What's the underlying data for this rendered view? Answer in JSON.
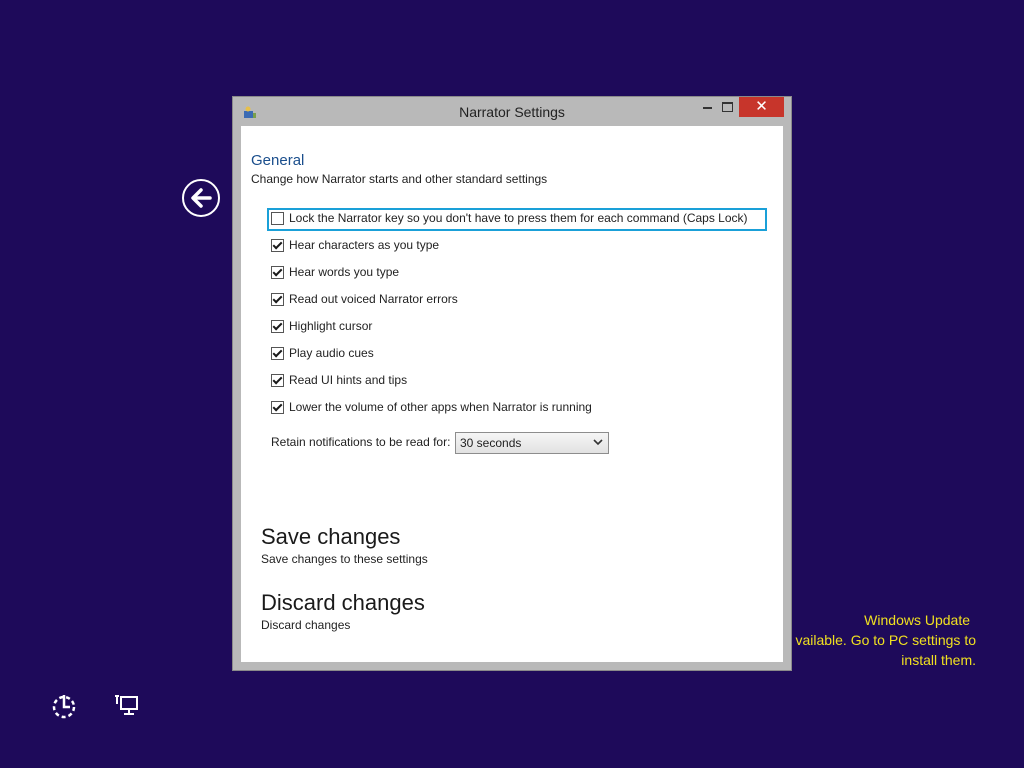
{
  "window": {
    "title": "Narrator Settings",
    "close_glyph": "✕"
  },
  "general": {
    "heading": "General",
    "subtitle": "Change how Narrator starts and other standard settings"
  },
  "options": [
    {
      "label": "Lock the Narrator key so you don't have to press them for each command (Caps Lock)",
      "checked": false
    },
    {
      "label": "Hear characters as you type",
      "checked": true
    },
    {
      "label": "Hear words you type",
      "checked": true
    },
    {
      "label": "Read out voiced Narrator errors",
      "checked": true
    },
    {
      "label": "Highlight cursor",
      "checked": true
    },
    {
      "label": "Play audio cues",
      "checked": true
    },
    {
      "label": "Read UI hints and tips",
      "checked": true
    },
    {
      "label": "Lower the volume of other apps when Narrator is running",
      "checked": true
    }
  ],
  "retain": {
    "label": "Retain notifications to be read for:",
    "selected": "30 seconds"
  },
  "save": {
    "title": "Save changes",
    "desc": "Save changes to these settings"
  },
  "discard": {
    "title": "Discard changes",
    "desc": "Discard changes"
  },
  "notification": {
    "line1": "Windows Update",
    "line2": "vailable. Go to PC settings to",
    "line3": "install them."
  },
  "colors": {
    "desktop": "#1e0a5a",
    "focus_border": "#1aa0d8",
    "close_button": "#c7352b",
    "heading": "#1a4e8c",
    "notification_text": "#f0e020"
  },
  "icons": [
    "back-arrow-icon",
    "narrator-app-icon",
    "ease-of-access-icon",
    "network-icon",
    "chevron-down-icon"
  ]
}
